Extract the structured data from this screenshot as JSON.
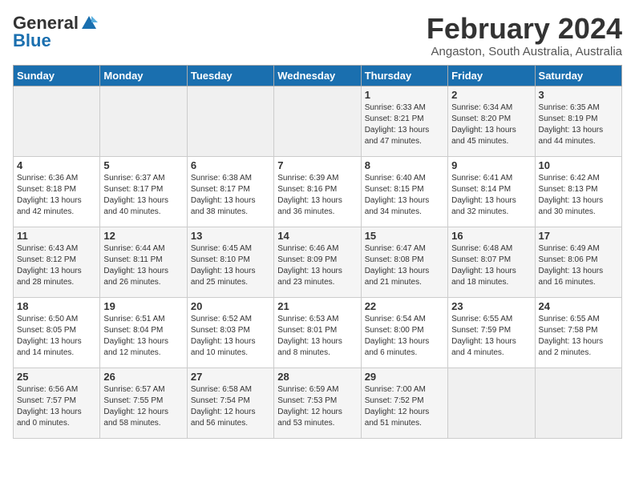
{
  "header": {
    "logo_general": "General",
    "logo_blue": "Blue",
    "month": "February 2024",
    "location": "Angaston, South Australia, Australia"
  },
  "days_of_week": [
    "Sunday",
    "Monday",
    "Tuesday",
    "Wednesday",
    "Thursday",
    "Friday",
    "Saturday"
  ],
  "weeks": [
    [
      {
        "num": "",
        "empty": true
      },
      {
        "num": "",
        "empty": true
      },
      {
        "num": "",
        "empty": true
      },
      {
        "num": "",
        "empty": true
      },
      {
        "num": "1",
        "sunrise": "Sunrise: 6:33 AM",
        "sunset": "Sunset: 8:21 PM",
        "daylight": "Daylight: 13 hours and 47 minutes."
      },
      {
        "num": "2",
        "sunrise": "Sunrise: 6:34 AM",
        "sunset": "Sunset: 8:20 PM",
        "daylight": "Daylight: 13 hours and 45 minutes."
      },
      {
        "num": "3",
        "sunrise": "Sunrise: 6:35 AM",
        "sunset": "Sunset: 8:19 PM",
        "daylight": "Daylight: 13 hours and 44 minutes."
      }
    ],
    [
      {
        "num": "4",
        "sunrise": "Sunrise: 6:36 AM",
        "sunset": "Sunset: 8:18 PM",
        "daylight": "Daylight: 13 hours and 42 minutes."
      },
      {
        "num": "5",
        "sunrise": "Sunrise: 6:37 AM",
        "sunset": "Sunset: 8:17 PM",
        "daylight": "Daylight: 13 hours and 40 minutes."
      },
      {
        "num": "6",
        "sunrise": "Sunrise: 6:38 AM",
        "sunset": "Sunset: 8:17 PM",
        "daylight": "Daylight: 13 hours and 38 minutes."
      },
      {
        "num": "7",
        "sunrise": "Sunrise: 6:39 AM",
        "sunset": "Sunset: 8:16 PM",
        "daylight": "Daylight: 13 hours and 36 minutes."
      },
      {
        "num": "8",
        "sunrise": "Sunrise: 6:40 AM",
        "sunset": "Sunset: 8:15 PM",
        "daylight": "Daylight: 13 hours and 34 minutes."
      },
      {
        "num": "9",
        "sunrise": "Sunrise: 6:41 AM",
        "sunset": "Sunset: 8:14 PM",
        "daylight": "Daylight: 13 hours and 32 minutes."
      },
      {
        "num": "10",
        "sunrise": "Sunrise: 6:42 AM",
        "sunset": "Sunset: 8:13 PM",
        "daylight": "Daylight: 13 hours and 30 minutes."
      }
    ],
    [
      {
        "num": "11",
        "sunrise": "Sunrise: 6:43 AM",
        "sunset": "Sunset: 8:12 PM",
        "daylight": "Daylight: 13 hours and 28 minutes."
      },
      {
        "num": "12",
        "sunrise": "Sunrise: 6:44 AM",
        "sunset": "Sunset: 8:11 PM",
        "daylight": "Daylight: 13 hours and 26 minutes."
      },
      {
        "num": "13",
        "sunrise": "Sunrise: 6:45 AM",
        "sunset": "Sunset: 8:10 PM",
        "daylight": "Daylight: 13 hours and 25 minutes."
      },
      {
        "num": "14",
        "sunrise": "Sunrise: 6:46 AM",
        "sunset": "Sunset: 8:09 PM",
        "daylight": "Daylight: 13 hours and 23 minutes."
      },
      {
        "num": "15",
        "sunrise": "Sunrise: 6:47 AM",
        "sunset": "Sunset: 8:08 PM",
        "daylight": "Daylight: 13 hours and 21 minutes."
      },
      {
        "num": "16",
        "sunrise": "Sunrise: 6:48 AM",
        "sunset": "Sunset: 8:07 PM",
        "daylight": "Daylight: 13 hours and 18 minutes."
      },
      {
        "num": "17",
        "sunrise": "Sunrise: 6:49 AM",
        "sunset": "Sunset: 8:06 PM",
        "daylight": "Daylight: 13 hours and 16 minutes."
      }
    ],
    [
      {
        "num": "18",
        "sunrise": "Sunrise: 6:50 AM",
        "sunset": "Sunset: 8:05 PM",
        "daylight": "Daylight: 13 hours and 14 minutes."
      },
      {
        "num": "19",
        "sunrise": "Sunrise: 6:51 AM",
        "sunset": "Sunset: 8:04 PM",
        "daylight": "Daylight: 13 hours and 12 minutes."
      },
      {
        "num": "20",
        "sunrise": "Sunrise: 6:52 AM",
        "sunset": "Sunset: 8:03 PM",
        "daylight": "Daylight: 13 hours and 10 minutes."
      },
      {
        "num": "21",
        "sunrise": "Sunrise: 6:53 AM",
        "sunset": "Sunset: 8:01 PM",
        "daylight": "Daylight: 13 hours and 8 minutes."
      },
      {
        "num": "22",
        "sunrise": "Sunrise: 6:54 AM",
        "sunset": "Sunset: 8:00 PM",
        "daylight": "Daylight: 13 hours and 6 minutes."
      },
      {
        "num": "23",
        "sunrise": "Sunrise: 6:55 AM",
        "sunset": "Sunset: 7:59 PM",
        "daylight": "Daylight: 13 hours and 4 minutes."
      },
      {
        "num": "24",
        "sunrise": "Sunrise: 6:55 AM",
        "sunset": "Sunset: 7:58 PM",
        "daylight": "Daylight: 13 hours and 2 minutes."
      }
    ],
    [
      {
        "num": "25",
        "sunrise": "Sunrise: 6:56 AM",
        "sunset": "Sunset: 7:57 PM",
        "daylight": "Daylight: 13 hours and 0 minutes."
      },
      {
        "num": "26",
        "sunrise": "Sunrise: 6:57 AM",
        "sunset": "Sunset: 7:55 PM",
        "daylight": "Daylight: 12 hours and 58 minutes."
      },
      {
        "num": "27",
        "sunrise": "Sunrise: 6:58 AM",
        "sunset": "Sunset: 7:54 PM",
        "daylight": "Daylight: 12 hours and 56 minutes."
      },
      {
        "num": "28",
        "sunrise": "Sunrise: 6:59 AM",
        "sunset": "Sunset: 7:53 PM",
        "daylight": "Daylight: 12 hours and 53 minutes."
      },
      {
        "num": "29",
        "sunrise": "Sunrise: 7:00 AM",
        "sunset": "Sunset: 7:52 PM",
        "daylight": "Daylight: 12 hours and 51 minutes."
      },
      {
        "num": "",
        "empty": true
      },
      {
        "num": "",
        "empty": true
      }
    ]
  ]
}
